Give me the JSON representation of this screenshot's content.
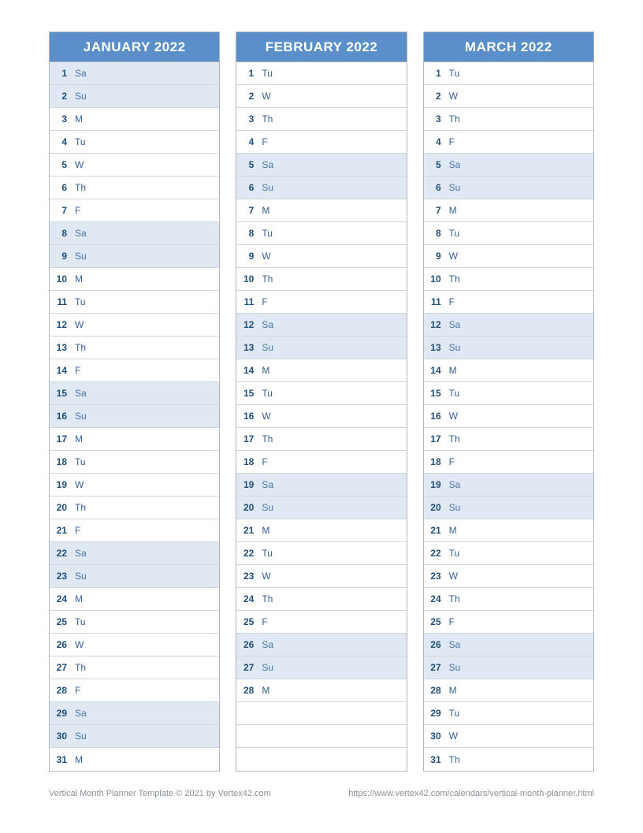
{
  "months": [
    {
      "title": "JANUARY 2022",
      "days": [
        {
          "n": "1",
          "d": "Sa",
          "w": true
        },
        {
          "n": "2",
          "d": "Su",
          "w": true
        },
        {
          "n": "3",
          "d": "M",
          "w": false
        },
        {
          "n": "4",
          "d": "Tu",
          "w": false
        },
        {
          "n": "5",
          "d": "W",
          "w": false
        },
        {
          "n": "6",
          "d": "Th",
          "w": false
        },
        {
          "n": "7",
          "d": "F",
          "w": false
        },
        {
          "n": "8",
          "d": "Sa",
          "w": true
        },
        {
          "n": "9",
          "d": "Su",
          "w": true
        },
        {
          "n": "10",
          "d": "M",
          "w": false
        },
        {
          "n": "11",
          "d": "Tu",
          "w": false
        },
        {
          "n": "12",
          "d": "W",
          "w": false
        },
        {
          "n": "13",
          "d": "Th",
          "w": false
        },
        {
          "n": "14",
          "d": "F",
          "w": false
        },
        {
          "n": "15",
          "d": "Sa",
          "w": true
        },
        {
          "n": "16",
          "d": "Su",
          "w": true
        },
        {
          "n": "17",
          "d": "M",
          "w": false
        },
        {
          "n": "18",
          "d": "Tu",
          "w": false
        },
        {
          "n": "19",
          "d": "W",
          "w": false
        },
        {
          "n": "20",
          "d": "Th",
          "w": false
        },
        {
          "n": "21",
          "d": "F",
          "w": false
        },
        {
          "n": "22",
          "d": "Sa",
          "w": true
        },
        {
          "n": "23",
          "d": "Su",
          "w": true
        },
        {
          "n": "24",
          "d": "M",
          "w": false
        },
        {
          "n": "25",
          "d": "Tu",
          "w": false
        },
        {
          "n": "26",
          "d": "W",
          "w": false
        },
        {
          "n": "27",
          "d": "Th",
          "w": false
        },
        {
          "n": "28",
          "d": "F",
          "w": false
        },
        {
          "n": "29",
          "d": "Sa",
          "w": true
        },
        {
          "n": "30",
          "d": "Su",
          "w": true
        },
        {
          "n": "31",
          "d": "M",
          "w": false
        }
      ]
    },
    {
      "title": "FEBRUARY 2022",
      "days": [
        {
          "n": "1",
          "d": "Tu",
          "w": false
        },
        {
          "n": "2",
          "d": "W",
          "w": false
        },
        {
          "n": "3",
          "d": "Th",
          "w": false
        },
        {
          "n": "4",
          "d": "F",
          "w": false
        },
        {
          "n": "5",
          "d": "Sa",
          "w": true
        },
        {
          "n": "6",
          "d": "Su",
          "w": true
        },
        {
          "n": "7",
          "d": "M",
          "w": false
        },
        {
          "n": "8",
          "d": "Tu",
          "w": false
        },
        {
          "n": "9",
          "d": "W",
          "w": false
        },
        {
          "n": "10",
          "d": "Th",
          "w": false
        },
        {
          "n": "11",
          "d": "F",
          "w": false
        },
        {
          "n": "12",
          "d": "Sa",
          "w": true
        },
        {
          "n": "13",
          "d": "Su",
          "w": true
        },
        {
          "n": "14",
          "d": "M",
          "w": false
        },
        {
          "n": "15",
          "d": "Tu",
          "w": false
        },
        {
          "n": "16",
          "d": "W",
          "w": false
        },
        {
          "n": "17",
          "d": "Th",
          "w": false
        },
        {
          "n": "18",
          "d": "F",
          "w": false
        },
        {
          "n": "19",
          "d": "Sa",
          "w": true
        },
        {
          "n": "20",
          "d": "Su",
          "w": true
        },
        {
          "n": "21",
          "d": "M",
          "w": false
        },
        {
          "n": "22",
          "d": "Tu",
          "w": false
        },
        {
          "n": "23",
          "d": "W",
          "w": false
        },
        {
          "n": "24",
          "d": "Th",
          "w": false
        },
        {
          "n": "25",
          "d": "F",
          "w": false
        },
        {
          "n": "26",
          "d": "Sa",
          "w": true
        },
        {
          "n": "27",
          "d": "Su",
          "w": true
        },
        {
          "n": "28",
          "d": "M",
          "w": false
        },
        {
          "n": "",
          "d": "",
          "w": false
        },
        {
          "n": "",
          "d": "",
          "w": false
        },
        {
          "n": "",
          "d": "",
          "w": false
        }
      ]
    },
    {
      "title": "MARCH 2022",
      "days": [
        {
          "n": "1",
          "d": "Tu",
          "w": false
        },
        {
          "n": "2",
          "d": "W",
          "w": false
        },
        {
          "n": "3",
          "d": "Th",
          "w": false
        },
        {
          "n": "4",
          "d": "F",
          "w": false
        },
        {
          "n": "5",
          "d": "Sa",
          "w": true
        },
        {
          "n": "6",
          "d": "Su",
          "w": true
        },
        {
          "n": "7",
          "d": "M",
          "w": false
        },
        {
          "n": "8",
          "d": "Tu",
          "w": false
        },
        {
          "n": "9",
          "d": "W",
          "w": false
        },
        {
          "n": "10",
          "d": "Th",
          "w": false
        },
        {
          "n": "11",
          "d": "F",
          "w": false
        },
        {
          "n": "12",
          "d": "Sa",
          "w": true
        },
        {
          "n": "13",
          "d": "Su",
          "w": true
        },
        {
          "n": "14",
          "d": "M",
          "w": false
        },
        {
          "n": "15",
          "d": "Tu",
          "w": false
        },
        {
          "n": "16",
          "d": "W",
          "w": false
        },
        {
          "n": "17",
          "d": "Th",
          "w": false
        },
        {
          "n": "18",
          "d": "F",
          "w": false
        },
        {
          "n": "19",
          "d": "Sa",
          "w": true
        },
        {
          "n": "20",
          "d": "Su",
          "w": true
        },
        {
          "n": "21",
          "d": "M",
          "w": false
        },
        {
          "n": "22",
          "d": "Tu",
          "w": false
        },
        {
          "n": "23",
          "d": "W",
          "w": false
        },
        {
          "n": "24",
          "d": "Th",
          "w": false
        },
        {
          "n": "25",
          "d": "F",
          "w": false
        },
        {
          "n": "26",
          "d": "Sa",
          "w": true
        },
        {
          "n": "27",
          "d": "Su",
          "w": true
        },
        {
          "n": "28",
          "d": "M",
          "w": false
        },
        {
          "n": "29",
          "d": "Tu",
          "w": false
        },
        {
          "n": "30",
          "d": "W",
          "w": false
        },
        {
          "n": "31",
          "d": "Th",
          "w": false
        }
      ]
    }
  ],
  "footer": {
    "left": "Vertical Month Planner Template © 2021 by Vertex42.com",
    "right": "https://www.vertex42.com/calendars/vertical-month-planner.html"
  }
}
